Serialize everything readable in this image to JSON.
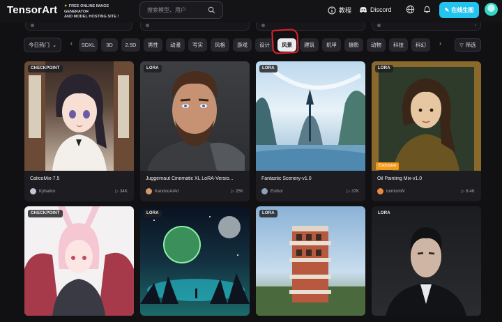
{
  "header": {
    "logo": "TensorArt",
    "promo_line1": "FREE ONLINE IMAGE GENERATOR",
    "promo_line2": "AND MODEL HOSTING SITE !",
    "search_placeholder": "搜索模型、用户",
    "tutorial_label": "教程",
    "discord_label": "Discord",
    "create_label": "在线生图",
    "colors": {
      "accent": "#22c3ef",
      "background": "#111114"
    }
  },
  "filters": {
    "sort_label": "今日热门",
    "tags": [
      "SDXL",
      "3D",
      "2.5D",
      "男性",
      "动漫",
      "写实",
      "风格",
      "游戏",
      "设计",
      "风景",
      "建筑",
      "机甲",
      "摄影",
      "动物",
      "科技",
      "科幻"
    ],
    "active_tag": "风景",
    "filter_label": "筛选",
    "highlight_color": "#e0222a"
  },
  "cards": [
    {
      "badge": "CHECKPOINT",
      "title": "CalicoMix-7.5",
      "author": "Kybalico",
      "runs": "34K",
      "exclusive": ""
    },
    {
      "badge": "LORA",
      "title": "Juggernaut Cinematic XL LoRA-Versio...",
      "author": "KandooAiArt",
      "runs": "25K",
      "exclusive": ""
    },
    {
      "badge": "LORA",
      "title": "Fantastic Scenery-v1.0",
      "author": "Esthol",
      "runs": "37K",
      "exclusive": ""
    },
    {
      "badge": "LORA",
      "title": "Oil Painting Mix-v1.0",
      "author": "tomtomW",
      "runs": "8.4K",
      "exclusive": "Exclusive"
    },
    {
      "badge": "CHECKPOINT",
      "title": "",
      "author": "",
      "runs": "",
      "exclusive": ""
    },
    {
      "badge": "LORA",
      "title": "",
      "author": "",
      "runs": "",
      "exclusive": ""
    },
    {
      "badge": "LORA",
      "title": "",
      "author": "",
      "runs": "",
      "exclusive": ""
    },
    {
      "badge": "LORA",
      "title": "",
      "author": "",
      "runs": "",
      "exclusive": ""
    }
  ]
}
